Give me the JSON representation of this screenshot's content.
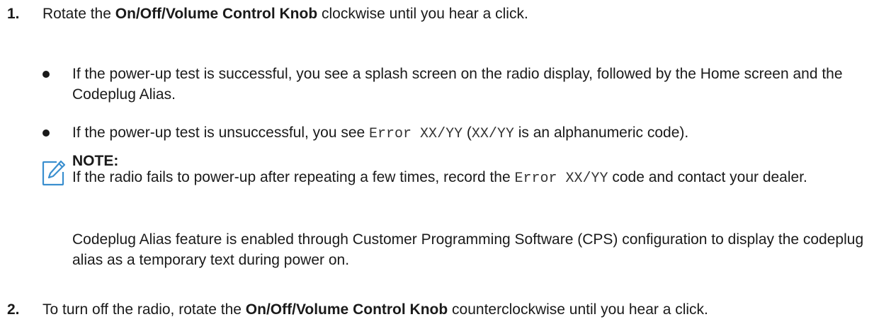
{
  "step1": {
    "number": "1.",
    "text_before": "Rotate the ",
    "bold": "On/Off/Volume Control Knob",
    "text_after": " clockwise until you hear a click."
  },
  "bullets": [
    {
      "text": "If the power-up test is successful, you see a splash screen on the radio display, followed by the Home screen and the Codeplug Alias."
    },
    {
      "text_before": "If the power-up test is unsuccessful, you see ",
      "code1": "Error XX/YY",
      "text_mid": " (",
      "code2": "XX/YY",
      "text_after": " is an alphanumeric code)."
    }
  ],
  "note": {
    "icon": "pencil-note-icon",
    "title": "NOTE:",
    "p1_before": "If the radio fails to power-up after repeating a few times, record the ",
    "p1_code": "Error XX/YY",
    "p1_after": " code and contact your dealer.",
    "p2": "Codeplug Alias feature is enabled through Customer Programming Software (CPS) configuration to display the codeplug alias as a temporary text during power on."
  },
  "step2": {
    "number": "2.",
    "text_before": "To turn off the radio, rotate the ",
    "bold": "On/Off/Volume Control Knob",
    "text_after": " counterclockwise until you hear a click."
  },
  "colors": {
    "accent": "#3a8fcf",
    "text": "#1a1a1a"
  }
}
